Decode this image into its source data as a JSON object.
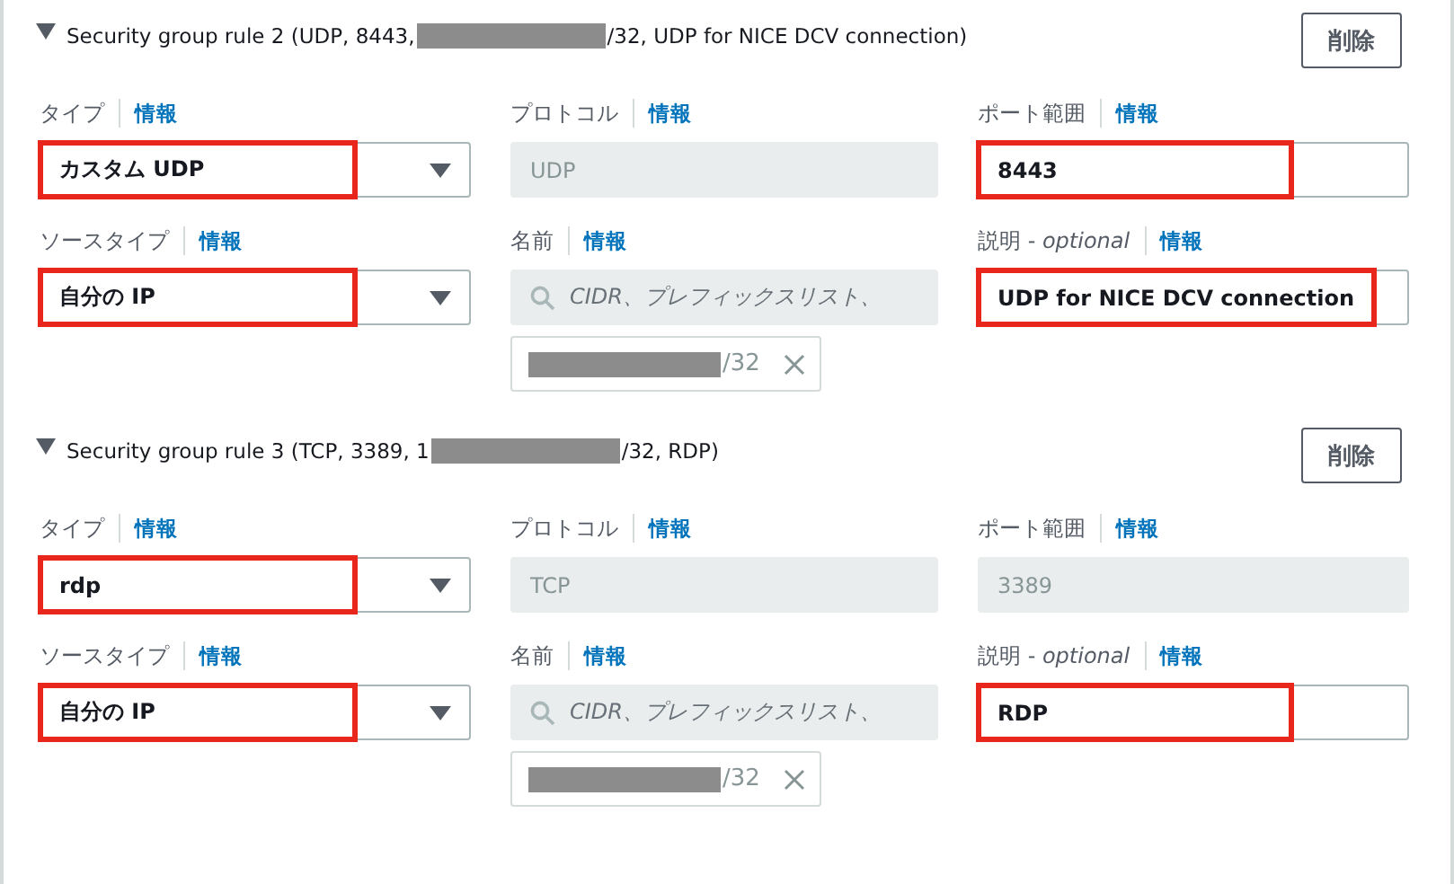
{
  "rules": [
    {
      "expanded": true,
      "title_before": "Security group rule 2 (UDP, 8443, ",
      "title_after": "/32, UDP for NICE DCV connection)",
      "delete_button": "削除",
      "fields": [
        {
          "label": "タイプ",
          "info": "情報",
          "kind": "select",
          "value": "カスタム UDP",
          "highlighted": true
        },
        {
          "label": "プロトコル",
          "info": "情報",
          "kind": "readonly",
          "value": "UDP",
          "highlighted": false
        },
        {
          "label": "ポート範囲",
          "info": "情報",
          "kind": "input",
          "value": "8443",
          "highlighted": true
        },
        {
          "label": "ソースタイプ",
          "info": "情報",
          "kind": "select",
          "value": "自分の IP",
          "highlighted": true
        },
        {
          "label": "名前",
          "info": "情報",
          "kind": "search",
          "placeholder": "CIDR、プレフィックスリスト、",
          "token": "/32",
          "highlighted": false
        },
        {
          "label": "説明 - *optional*",
          "info": "情報",
          "kind": "input",
          "value": "UDP for NICE DCV connection",
          "highlighted": true
        }
      ]
    },
    {
      "expanded": true,
      "title_before": "Security group rule 3 (TCP, 3389, 1",
      "title_after": "/32, RDP)",
      "delete_button": "削除",
      "fields": [
        {
          "label": "タイプ",
          "info": "情報",
          "kind": "select",
          "value": "rdp",
          "highlighted": true
        },
        {
          "label": "プロトコル",
          "info": "情報",
          "kind": "readonly",
          "value": "TCP",
          "highlighted": false
        },
        {
          "label": "ポート範囲",
          "info": "情報",
          "kind": "readonly",
          "value": "3389",
          "highlighted": false
        },
        {
          "label": "ソースタイプ",
          "info": "情報",
          "kind": "select",
          "value": "自分の IP",
          "highlighted": true
        },
        {
          "label": "名前",
          "info": "情報",
          "kind": "search",
          "placeholder": "CIDR、プレフィックスリスト、",
          "token": "/32",
          "highlighted": false
        },
        {
          "label": "説明 - *optional*",
          "info": "情報",
          "kind": "input",
          "value": "RDP",
          "highlighted": true
        }
      ]
    }
  ]
}
